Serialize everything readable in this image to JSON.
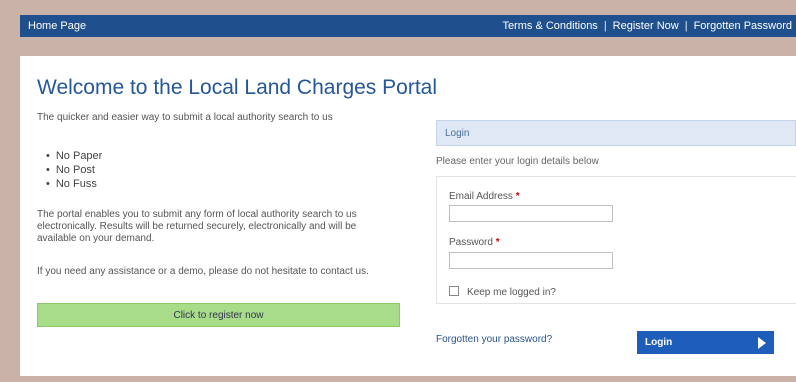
{
  "topbar": {
    "home_label": "Home Page",
    "links": [
      "Terms & Conditions",
      "Register Now",
      "Forgotten Password"
    ]
  },
  "main": {
    "title": "Welcome to the Local Land Charges Portal",
    "intro": "The quicker and easier way to submit a local authority search to us",
    "bullets": [
      "No Paper",
      "No Post",
      "No Fuss"
    ],
    "para1": "The portal enables you to submit any form of local authority search to us electronically. Results will be returned securely, electronically and will be available on your demand.",
    "para2": "If you need any assistance or a demo, please do not hesitate to contact us.",
    "register_button": "Click to register now"
  },
  "login": {
    "header": "Login",
    "subtitle": "Please enter your login details below",
    "email_label": "Email Address",
    "email_value": "",
    "password_label": "Password",
    "password_value": "",
    "required_marker": "*",
    "remember_label": "Keep me logged in?",
    "remember_checked": false,
    "forgot_link": "Forgotten your password?",
    "login_button": "Login"
  },
  "colors": {
    "topbar": "#1f4f8c",
    "title": "#24579a",
    "register_button": "#a8dc88",
    "login_header_bg": "#dfe8f4",
    "login_button": "#1f5dbb",
    "page_background": "#c9b2a8"
  }
}
